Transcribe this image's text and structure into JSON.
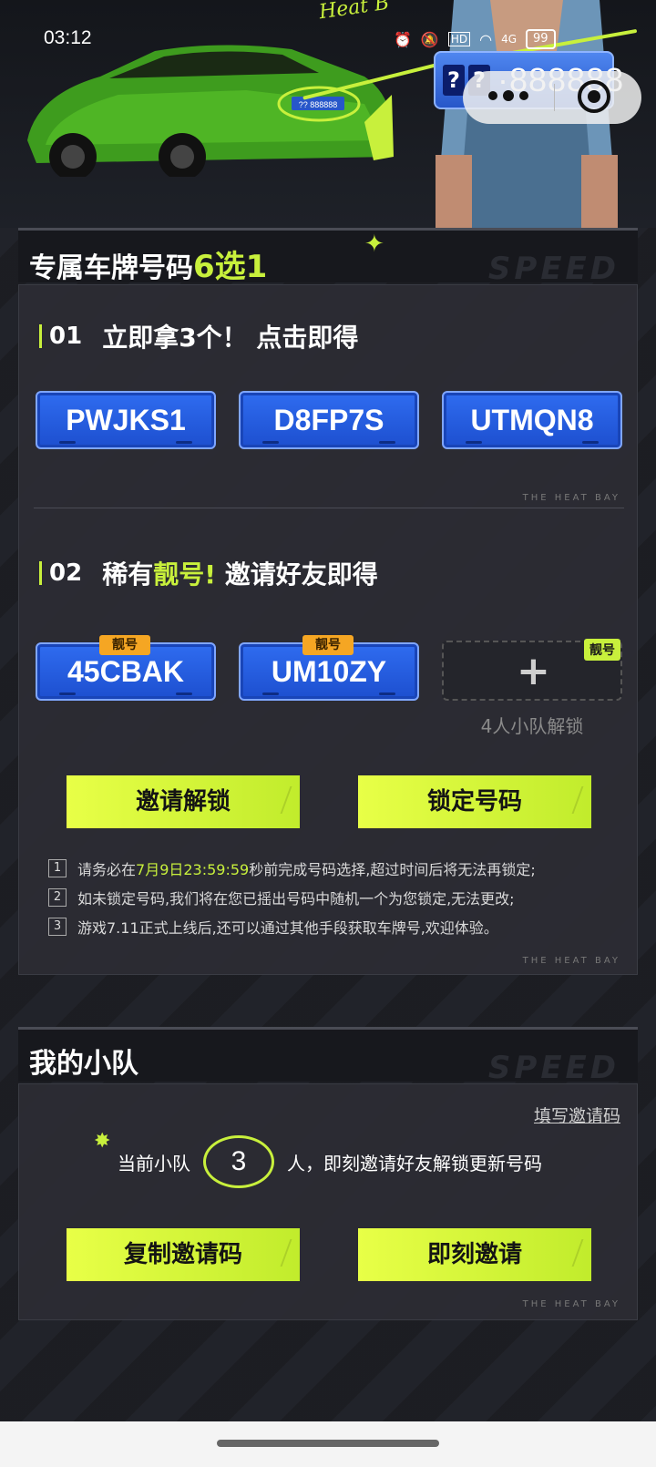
{
  "status_bar": {
    "time": "03:12",
    "battery": "99",
    "network": "4G",
    "hd": "HD"
  },
  "hero": {
    "slogan": "Heat B",
    "plate_province": [
      "?",
      "?"
    ],
    "plate_number": "·888888",
    "car_plate": "?? 888888"
  },
  "section1": {
    "title_prefix": "专属车牌号码",
    "title_highlight": "6选1",
    "bg_word": "SPEED",
    "step1": {
      "no": "01",
      "text": "立即拿3个！ 点击即得"
    },
    "plates_free": [
      "PWJKS1",
      "D8FP7S",
      "UTMQN8"
    ],
    "step2": {
      "no": "02",
      "text_a": "稀有",
      "text_hl": "靓号!",
      "text_b": " 邀请好友即得"
    },
    "plates_rare": [
      "45CBAK",
      "UM10ZY"
    ],
    "badge": "靓号",
    "locked_caption": "4人小队解锁",
    "btn_invite_unlock": "邀请解锁",
    "btn_lock_number": "锁定号码",
    "notes": [
      {
        "num": "1",
        "pre": "请务必在",
        "hl": "7月9日23:59:59",
        "post": "秒前完成号码选择,超过时间后将无法再锁定;"
      },
      {
        "num": "2",
        "pre": "如未锁定号码,我们将在您已摇出号码中随机一个为您锁定,无法更改;",
        "hl": "",
        "post": ""
      },
      {
        "num": "3",
        "pre": "游戏7.11正式上线后,还可以通过其他手段获取车牌号,欢迎体验。",
        "hl": "",
        "post": ""
      }
    ],
    "watermark": "THE HEAT BAY"
  },
  "section2": {
    "title": "我的小队",
    "bg_word": "SPEED",
    "fill_code": "填写邀请码",
    "team_prefix": "当前小队",
    "team_count": "3",
    "team_suffix": "人，即刻邀请好友解锁更新号码",
    "btn_copy": "复制邀请码",
    "btn_invite": "即刻邀请",
    "watermark": "THE HEAT BAY"
  }
}
